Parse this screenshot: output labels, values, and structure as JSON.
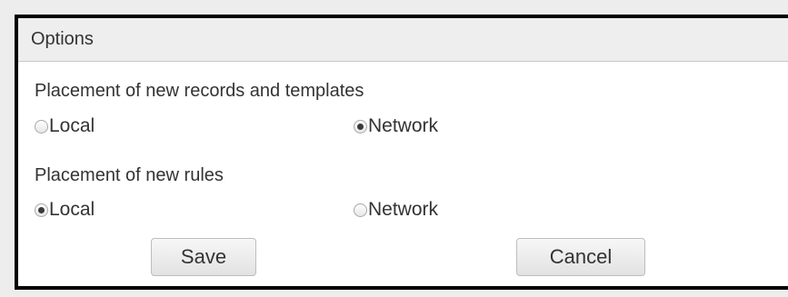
{
  "dialog": {
    "title": "Options",
    "records": {
      "label": "Placement of new records and templates",
      "options": [
        {
          "label": "Local",
          "checked": false
        },
        {
          "label": "Network",
          "checked": true
        }
      ]
    },
    "rules": {
      "label": "Placement of new rules",
      "options": [
        {
          "label": "Local",
          "checked": true
        },
        {
          "label": "Network",
          "checked": false
        }
      ]
    },
    "buttons": {
      "save": "Save",
      "cancel": "Cancel"
    }
  }
}
